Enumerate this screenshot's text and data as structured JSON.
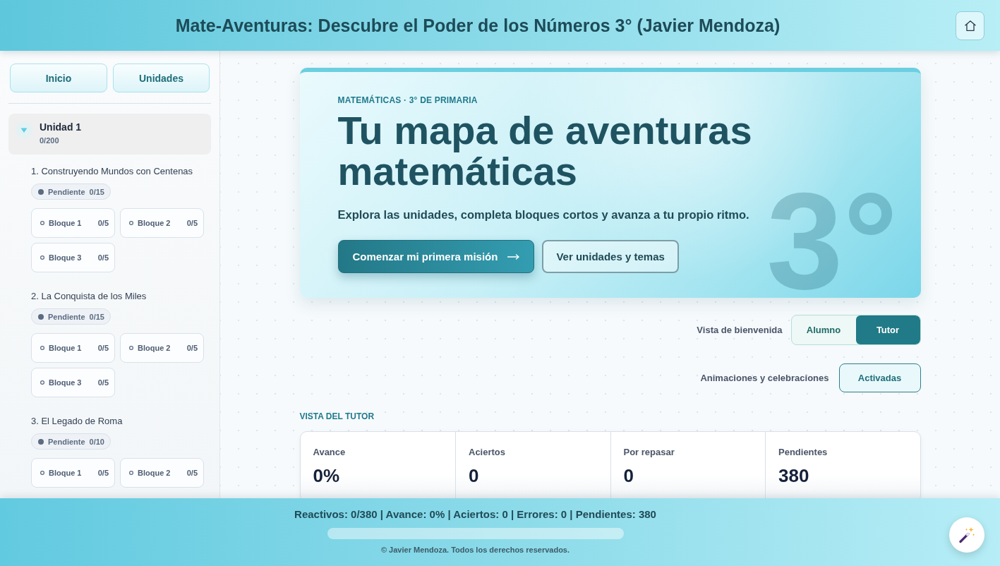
{
  "header": {
    "title": "Mate-Aventuras: Descubre el Poder de los Números 3° (Javier Mendoza)"
  },
  "sidebar": {
    "nav_buttons": [
      {
        "label": "Inicio"
      },
      {
        "label": "Unidades"
      }
    ],
    "units": [
      {
        "title": "Unidad 1",
        "count": "0/200",
        "expanded": true,
        "lessons": [
          {
            "title": "1. Construyendo Mundos con Centenas",
            "status": "Pendiente",
            "count": "0/15",
            "blocks": [
              {
                "label": "Bloque 1",
                "count": "0/5"
              },
              {
                "label": "Bloque 2",
                "count": "0/5"
              },
              {
                "label": "Bloque 3",
                "count": "0/5"
              }
            ]
          },
          {
            "title": "2. La Conquista de los Miles",
            "status": "Pendiente",
            "count": "0/15",
            "blocks": [
              {
                "label": "Bloque 1",
                "count": "0/5"
              },
              {
                "label": "Bloque 2",
                "count": "0/5"
              },
              {
                "label": "Bloque 3",
                "count": "0/5"
              }
            ]
          },
          {
            "title": "3. El Legado de Roma",
            "status": "Pendiente",
            "count": "0/10",
            "blocks": [
              {
                "label": "Bloque 1",
                "count": "0/5"
              },
              {
                "label": "Bloque 2",
                "count": "0/5"
              }
            ]
          }
        ]
      }
    ]
  },
  "hero": {
    "eyebrow": "MATEMÁTICAS · 3° DE PRIMARIA",
    "title": "Tu mapa de aventuras matemáticas",
    "subtitle": "Explora las unidades, completa bloques cortos y avanza a tu propio ritmo.",
    "decor_text": "3°",
    "buttons": [
      {
        "label": "Comenzar mi primera misión",
        "kind": "primary"
      },
      {
        "label": "Ver unidades y temas",
        "kind": "secondary"
      }
    ]
  },
  "welcome_view": {
    "label": "Vista de bienvenida",
    "options": [
      {
        "label": "Alumno",
        "selected": false
      },
      {
        "label": "Tutor",
        "selected": true
      }
    ]
  },
  "animations": {
    "label": "Animaciones y celebraciones",
    "value": "Activadas",
    "on": true
  },
  "tutor_view": {
    "heading": "VISTA DEL TUTOR",
    "stats": [
      {
        "label": "Avance",
        "value": "0%"
      },
      {
        "label": "Aciertos",
        "value": "0"
      },
      {
        "label": "Por repasar",
        "value": "0"
      },
      {
        "label": "Pendientes",
        "value": "380"
      }
    ]
  },
  "footer": {
    "summary": "Reactivos: 0/380 | Avance: 0% | Aciertos: 0 | Errores: 0 | Pendientes: 380",
    "progress": {
      "level": 0
    },
    "copyright": "© Javier Mendoza. Todos los derechos reservados."
  }
}
